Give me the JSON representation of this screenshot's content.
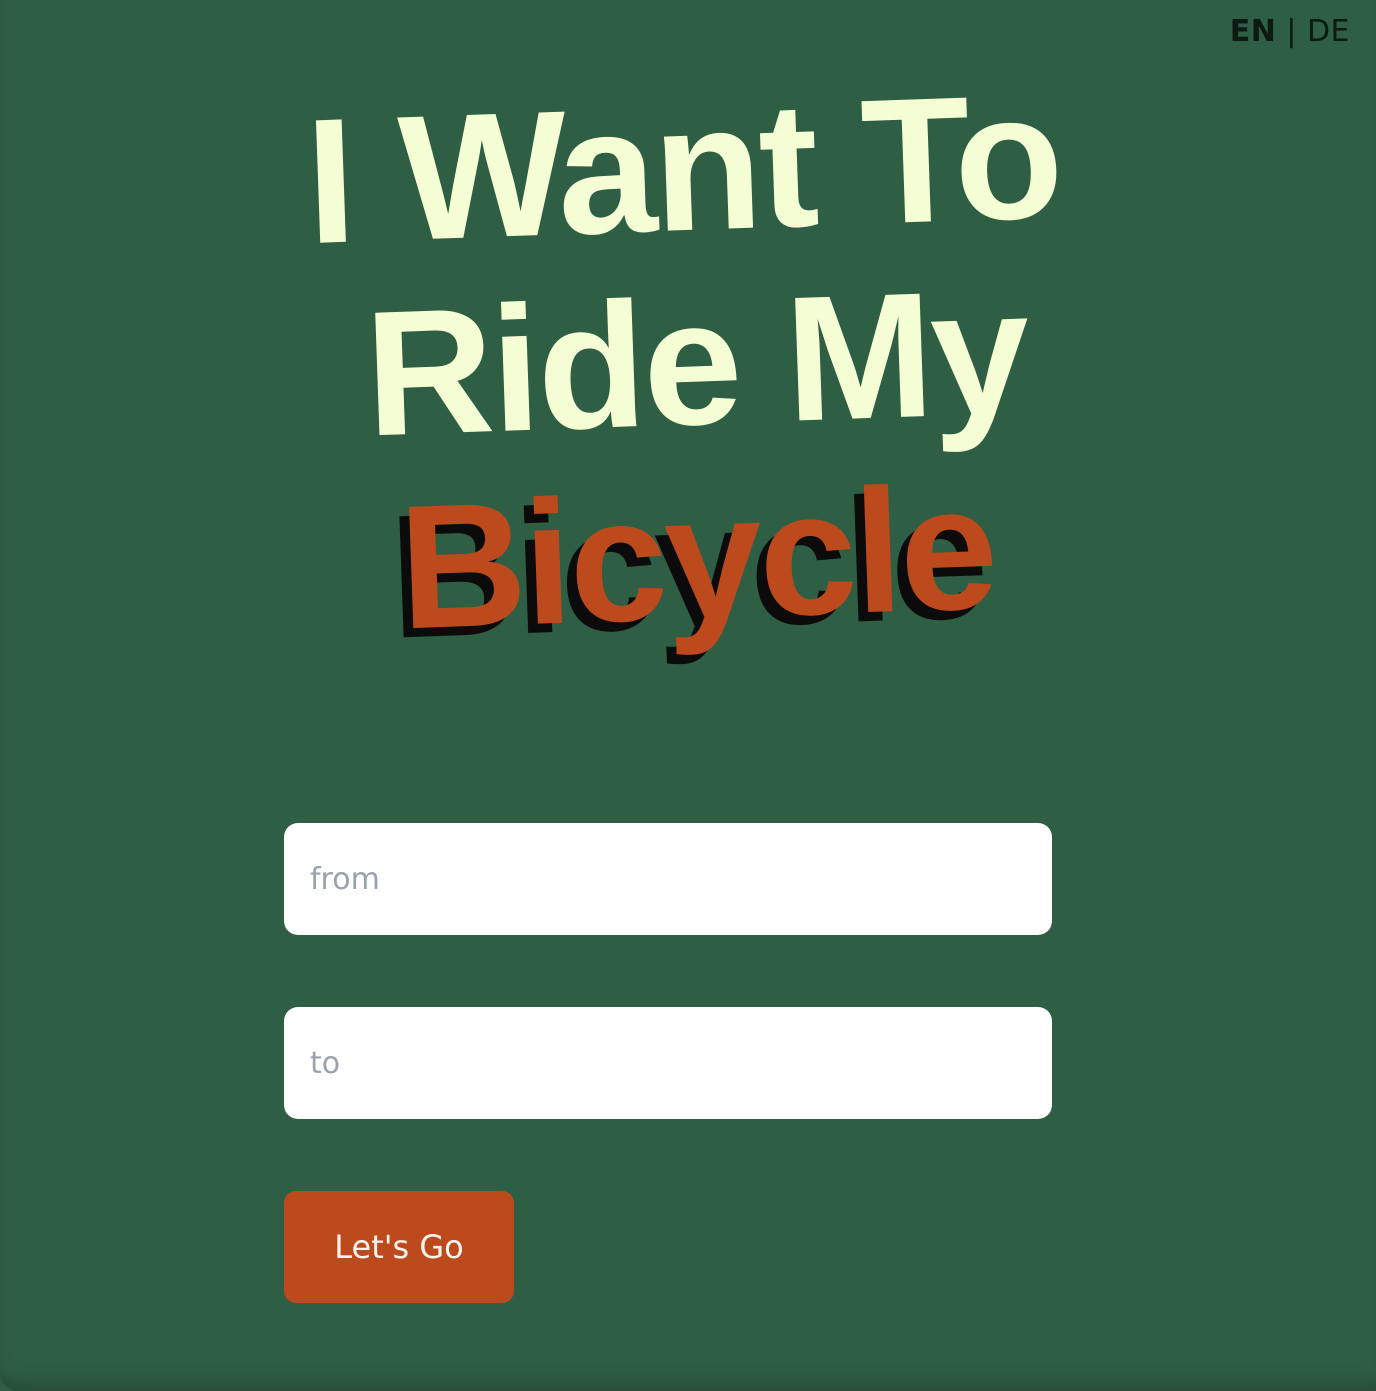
{
  "language_switcher": {
    "active": "EN",
    "separator": "|",
    "other": "DE"
  },
  "hero": {
    "line1": "I Want To",
    "line2": "Ride My",
    "line3": "Bicycle"
  },
  "form": {
    "from_placeholder": "from",
    "to_placeholder": "to",
    "from_value": "",
    "to_value": "",
    "submit_label": "Let's Go"
  },
  "colors": {
    "background": "#2e5e43",
    "title_light": "#f4fdd4",
    "accent": "#bd4a1c",
    "shadow": "#0b0b0b"
  }
}
